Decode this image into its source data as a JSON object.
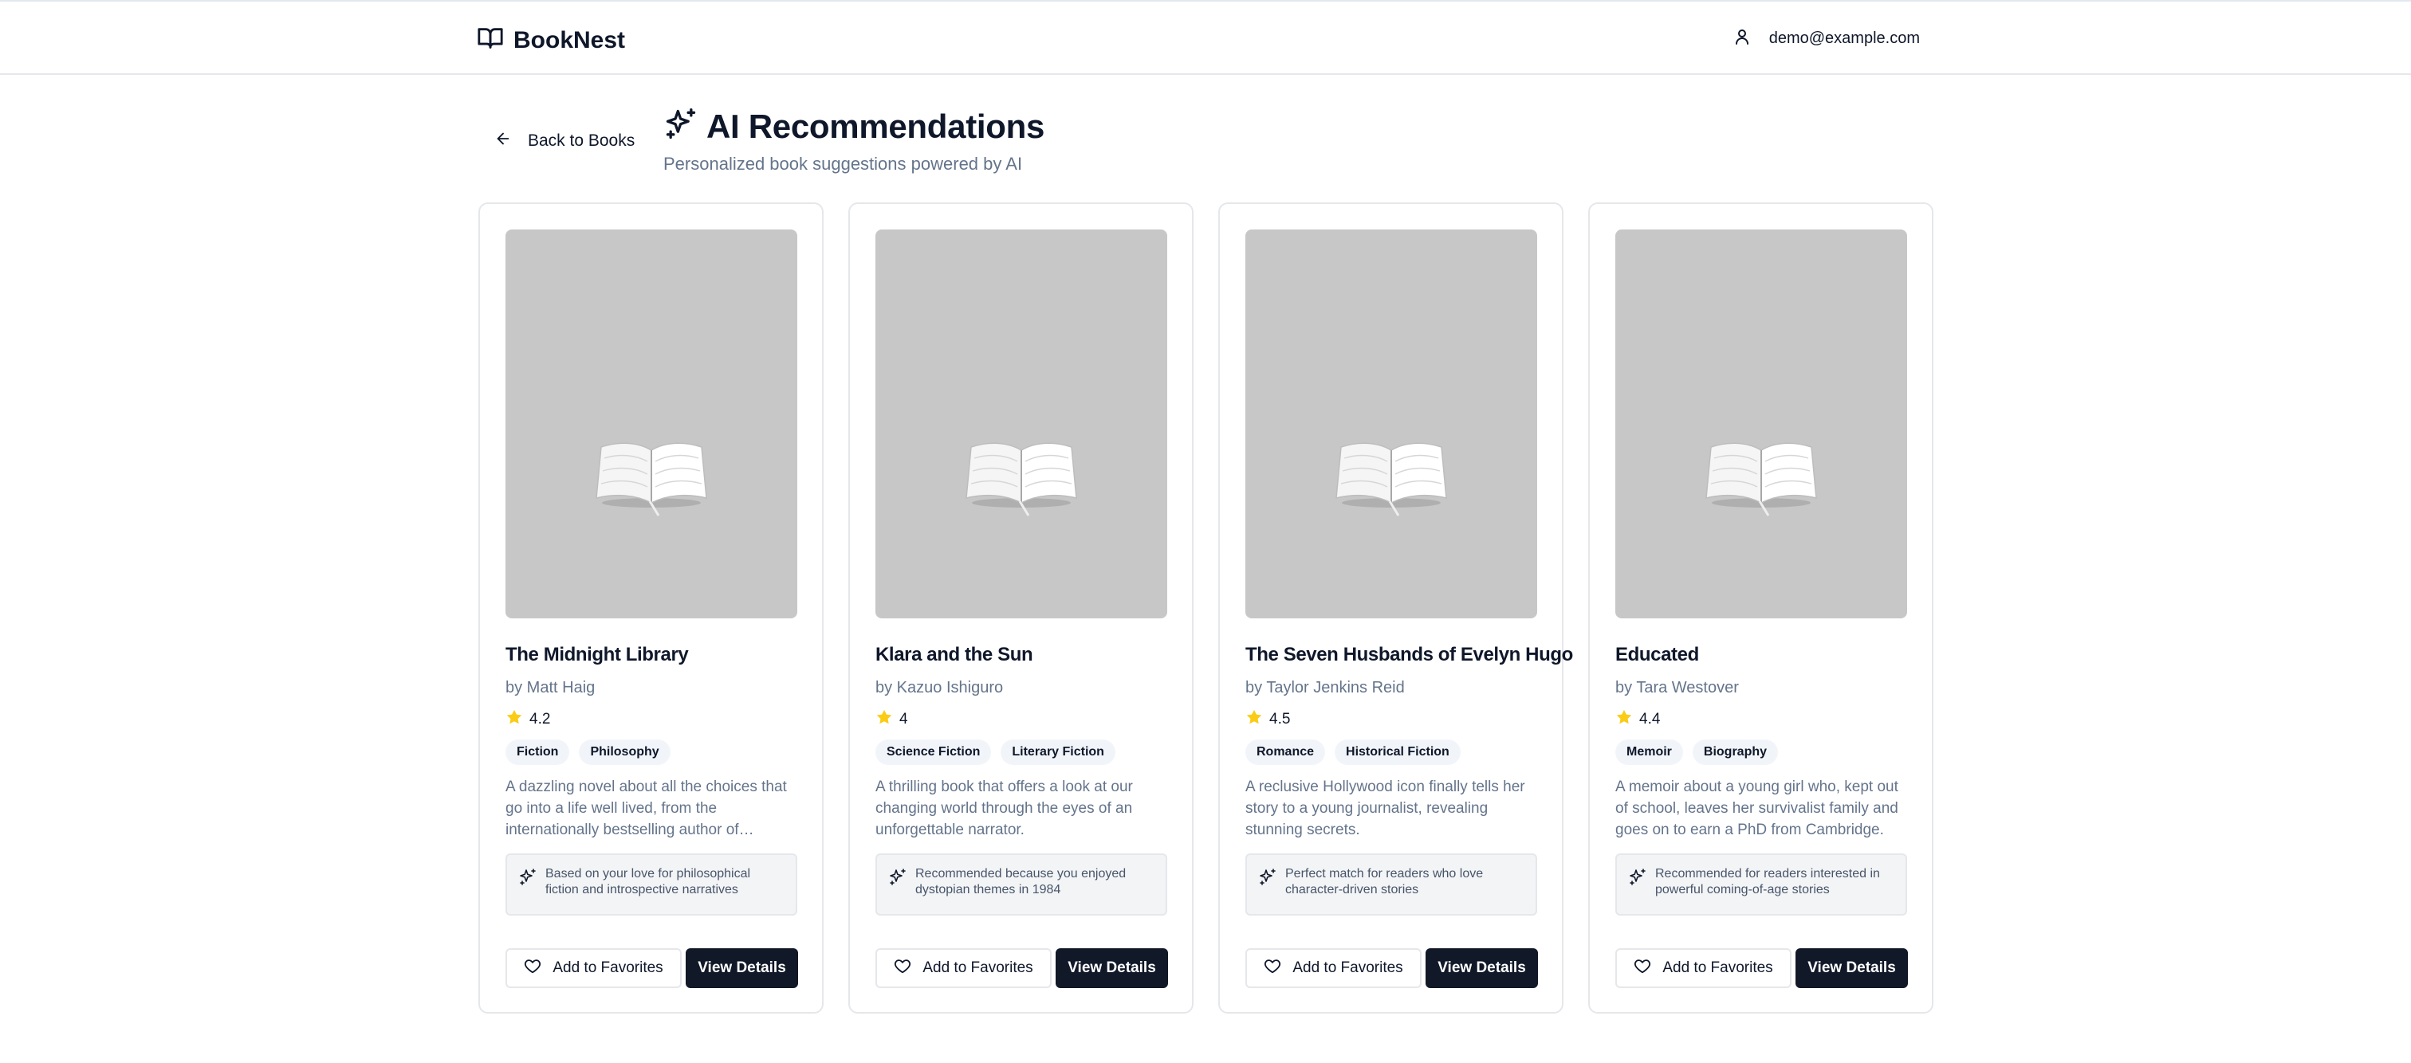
{
  "header": {
    "brand_name": "BookNest",
    "brand_icon": "open-book-icon",
    "user_icon": "user-icon",
    "user_email": "demo@example.com"
  },
  "nav": {
    "back_label": "Back to Books",
    "back_icon": "arrow-left-icon"
  },
  "page": {
    "title": "AI Recommendations",
    "title_icon": "sparkles-icon",
    "subtitle": "Personalized book suggestions powered by AI"
  },
  "colors": {
    "primary_button": "#111827",
    "star": "#facc15",
    "cover_placeholder": "#c7c7c7",
    "muted_text": "#64748b"
  },
  "books": [
    {
      "title": "The Midnight Library",
      "author": "by Matt Haig",
      "rating": "4.2",
      "tags": [
        "Fiction",
        "Philosophy"
      ],
      "description": "A dazzling novel about all the choices that go into a life well lived, from the internationally bestselling author of Reasons to Stay Alive.",
      "reason": "Based on your love for philosophical fiction and introspective narratives",
      "favorite_label": "Add to Favorites",
      "details_label": "View Details"
    },
    {
      "title": "Klara and the Sun",
      "author": "by Kazuo Ishiguro",
      "rating": "4",
      "tags": [
        "Science Fiction",
        "Literary Fiction"
      ],
      "description": "A thrilling book that offers a look at our changing world through the eyes of an unforgettable narrator.",
      "reason": "Recommended because you enjoyed dystopian themes in 1984",
      "favorite_label": "Add to Favorites",
      "details_label": "View Details"
    },
    {
      "title": "The Seven Husbands of Evelyn Hugo",
      "author": "by Taylor Jenkins Reid",
      "rating": "4.5",
      "tags": [
        "Romance",
        "Historical Fiction"
      ],
      "description": "A reclusive Hollywood icon finally tells her story to a young journalist, revealing stunning secrets.",
      "reason": "Perfect match for readers who love character-driven stories",
      "favorite_label": "Add to Favorites",
      "details_label": "View Details"
    },
    {
      "title": "Educated",
      "author": "by Tara Westover",
      "rating": "4.4",
      "tags": [
        "Memoir",
        "Biography"
      ],
      "description": "A memoir about a young girl who, kept out of school, leaves her survivalist family and goes on to earn a PhD from Cambridge.",
      "reason": "Recommended for readers interested in powerful coming-of-age stories",
      "favorite_label": "Add to Favorites",
      "details_label": "View Details"
    }
  ]
}
